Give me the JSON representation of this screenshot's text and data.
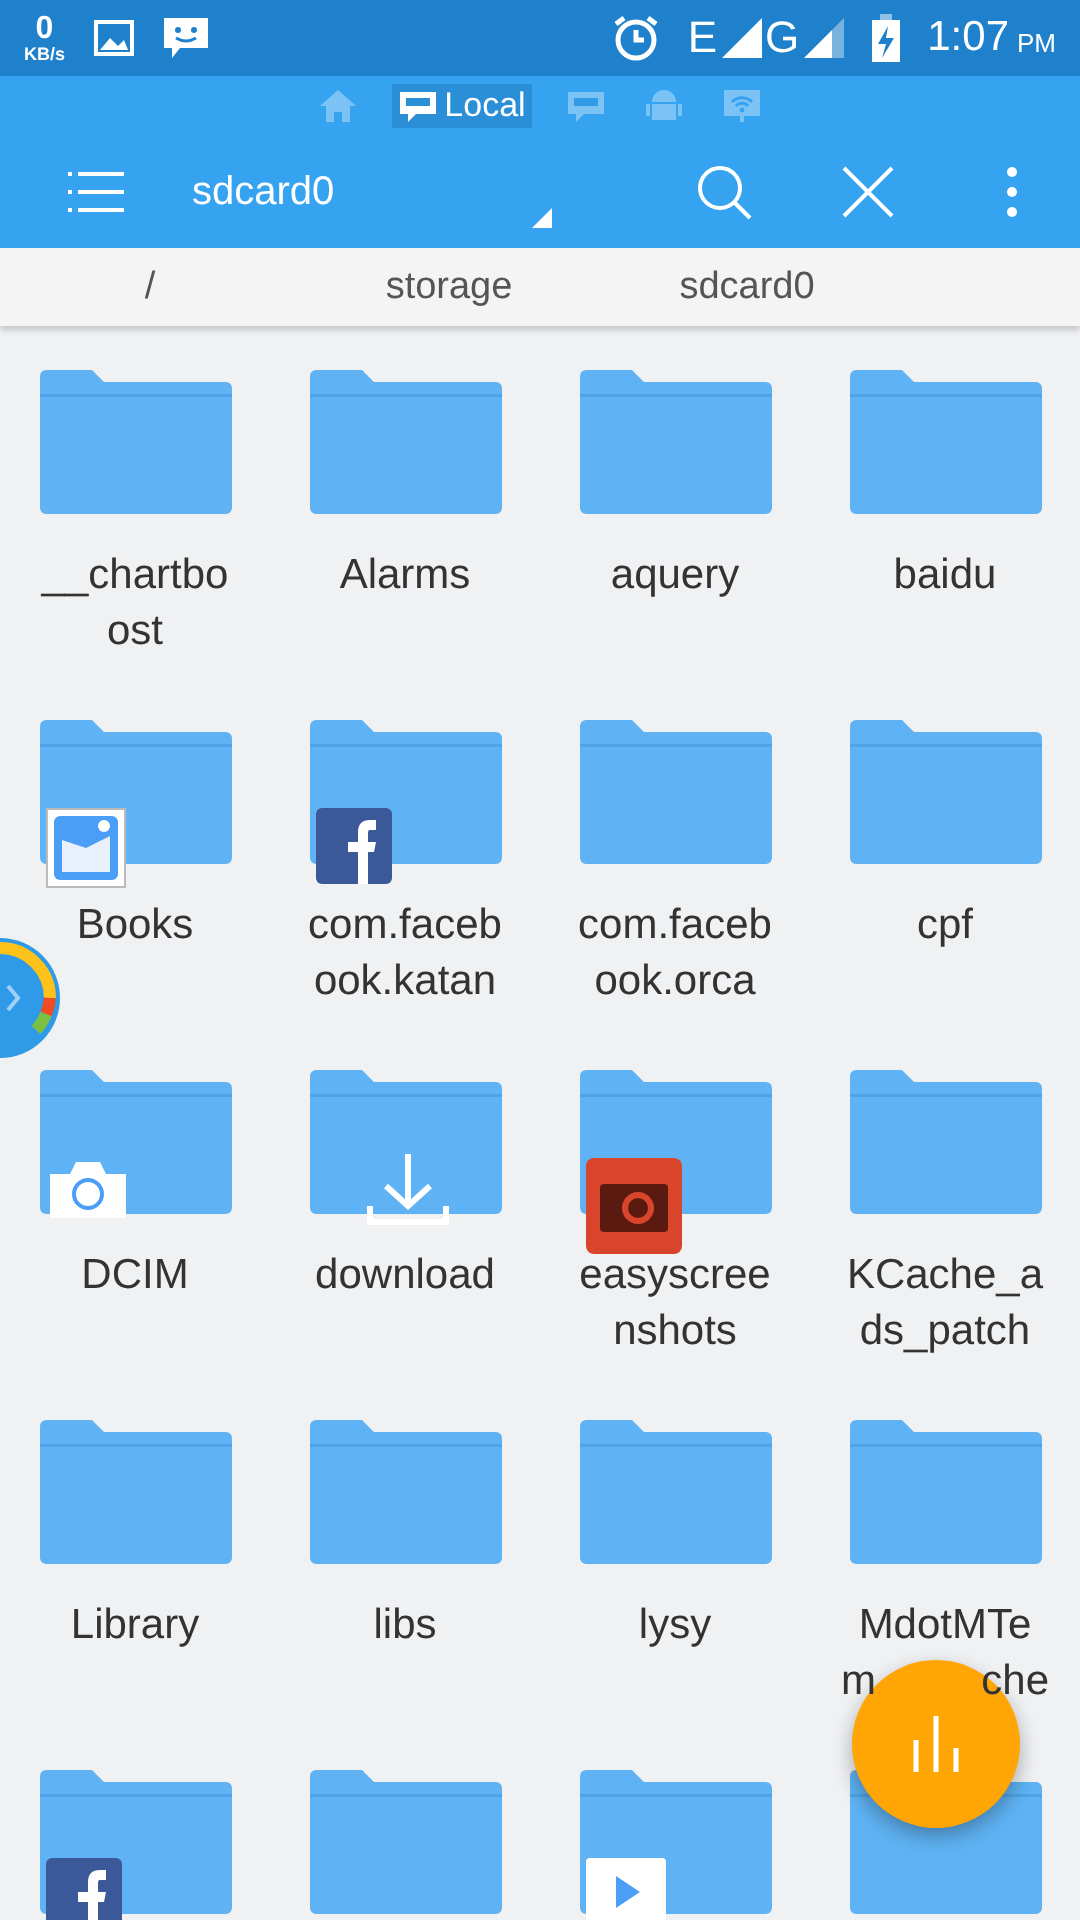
{
  "status_bar": {
    "speed": "0",
    "speed_unit": "KB/s",
    "network_1": "E",
    "network_2": "G",
    "time": "1:07",
    "ampm": "PM"
  },
  "source_tabs": [
    {
      "kind": "home",
      "selected": false
    },
    {
      "kind": "local",
      "label": "Local",
      "selected": true
    },
    {
      "kind": "sd",
      "selected": false
    },
    {
      "kind": "android",
      "selected": false
    },
    {
      "kind": "wifi",
      "selected": false
    }
  ],
  "toolbar": {
    "title": "sdcard0"
  },
  "breadcrumb": [
    "/",
    "storage",
    "sdcard0"
  ],
  "folders": [
    {
      "name": "__chartboost"
    },
    {
      "name": "Alarms"
    },
    {
      "name": "aquery"
    },
    {
      "name": "baidu"
    },
    {
      "name": "Books",
      "kind": "gallery"
    },
    {
      "name": "com.facebook.katan",
      "kind": "facebook"
    },
    {
      "name": "com.facebook.orca"
    },
    {
      "name": "cpf"
    },
    {
      "name": "DCIM",
      "kind": "camera"
    },
    {
      "name": "download",
      "kind": "download"
    },
    {
      "name": "easyscreenshots",
      "kind": "screenshot"
    },
    {
      "name": "KCache_ads_patch"
    },
    {
      "name": "Library"
    },
    {
      "name": "libs"
    },
    {
      "name": "lysy"
    },
    {
      "name": "MdotMTe",
      "name_fragments": [
        "m",
        "che"
      ]
    },
    {
      "kind": "facebook"
    },
    {
      "kind": "plain"
    },
    {
      "kind": "play"
    },
    {
      "kind": "plain"
    }
  ]
}
